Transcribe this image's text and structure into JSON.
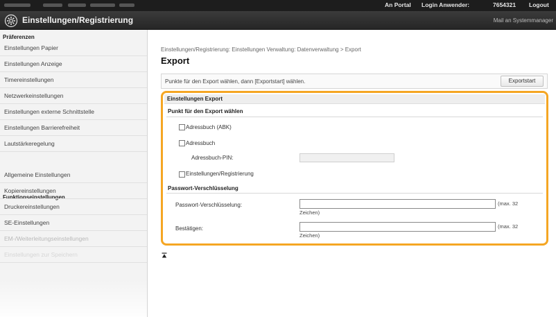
{
  "topbar": {
    "portal": "An Portal",
    "login_label": "Login Anwender:",
    "login_id": "7654321",
    "logout": "Logout"
  },
  "header": {
    "title": "Einstellungen/Registrierung",
    "mail_link": "Mail an Systemmanager"
  },
  "sidebar": {
    "section_preferences": "Präferenzen",
    "preferences": [
      "Einstellungen Papier",
      "Einstellungen Anzeige",
      "Timereinstellungen",
      "Netzwerkeinstellungen",
      "Einstellungen externe Schnittstelle",
      "Einstellungen Barrierefreiheit",
      "Lautstärkeregelung"
    ],
    "section_functions": "Funktionseinstellungen",
    "functions": [
      "Allgemeine Einstellungen",
      "Kopiereinstellungen",
      "Druckereinstellungen",
      "SE-Einstellungen",
      "EM-/Weiterleitungseinstellungen",
      "Einstellungen zur Speichern"
    ]
  },
  "main": {
    "breadcrumb": "Einstellungen/Registrierung: Einstellungen Verwaltung: Datenverwaltung > Export",
    "title": "Export",
    "instruction": "Punkte für den Export wählen, dann [Exportstart] wählen.",
    "export_button": "Exportstart",
    "panel_title": "Einstellungen Export",
    "select_heading": "Punkt für den Export wählen",
    "items": {
      "address_book_abk": "Adressbuch (ABK)",
      "address_book": "Adressbuch",
      "pin_label": "Adressbuch-PIN:",
      "settings": "Einstellungen/Registrierung"
    },
    "password_heading": "Passwort-Verschlüsselung",
    "password_label": "Passwort-Verschlüsselung:",
    "confirm_label": "Bestätigen:",
    "max_hint_1": "(max. 32",
    "max_hint_2": "Zeichen)"
  }
}
